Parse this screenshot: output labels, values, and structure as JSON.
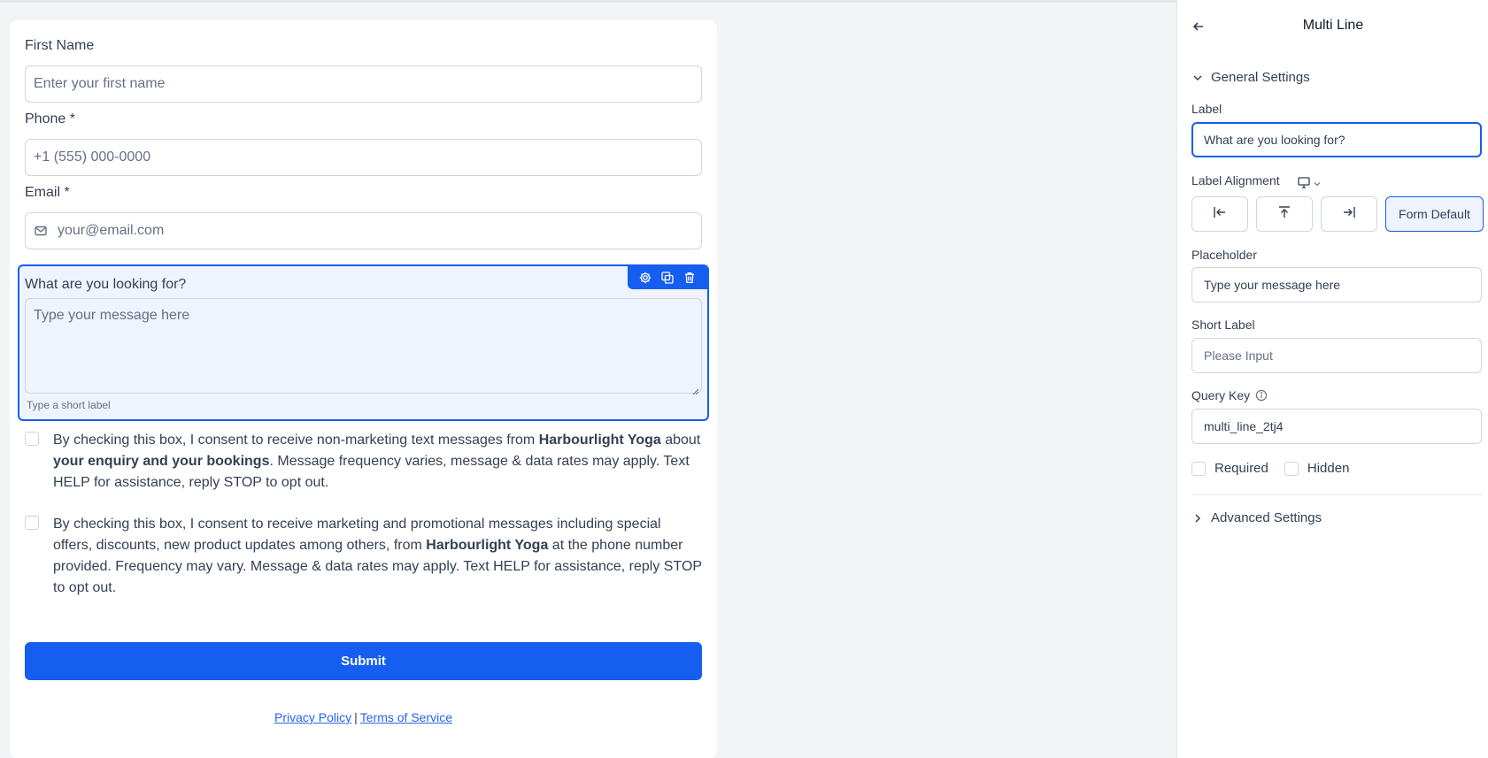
{
  "form": {
    "first_name": {
      "label": "First Name",
      "placeholder": "Enter your first name"
    },
    "phone": {
      "label": "Phone *",
      "placeholder": "+1 (555) 000-0000"
    },
    "email": {
      "label": "Email *",
      "placeholder": "your@email.com"
    },
    "multi_line": {
      "label": "What are you looking for?",
      "placeholder": "Type your message here",
      "short_label": "Type a short label"
    },
    "consent_1": {
      "p1": "By checking this box, I consent to receive non-marketing text messages from ",
      "b1": "Harbourlight Yoga",
      "p2": " about ",
      "b2": "your enquiry and your bookings",
      "p3": ". Message frequency varies, message & data rates may apply. Text HELP for assistance, reply STOP to opt out."
    },
    "consent_2": {
      "p1": "By checking this box, I consent to receive marketing and promotional messages including special offers, discounts, new product updates among others, from ",
      "b1": "Harbourlight Yoga",
      "p2": " at the phone number provided. Frequency may vary. Message & data rates may apply. Text HELP for assistance, reply STOP to opt out."
    },
    "submit_label": "Submit",
    "privacy_label": "Privacy Policy",
    "separator": "|",
    "terms_label": "Terms of Service"
  },
  "panel": {
    "title": "Multi Line",
    "general_settings": "General Settings",
    "label_label": "Label",
    "label_value": "What are you looking for?",
    "label_alignment": "Label Alignment",
    "form_default": "Form Default",
    "placeholder_label": "Placeholder",
    "placeholder_value": "Type your message here",
    "short_label_label": "Short Label",
    "short_label_placeholder": "Please Input",
    "query_key_label": "Query Key",
    "query_key_value": "multi_line_2tj4",
    "required_label": "Required",
    "hidden_label": "Hidden",
    "advanced_settings": "Advanced Settings"
  },
  "colors": {
    "primary": "#155eef",
    "selected_bg": "#eef3fe",
    "border": "#d0d5dd",
    "text": "#344054"
  },
  "icons": [
    "mail-icon",
    "gear-icon",
    "duplicate-icon",
    "trash-icon",
    "back-arrow-icon",
    "chevron-down-icon",
    "chevron-right-icon",
    "monitor-icon",
    "align-left-icon",
    "align-top-icon",
    "align-right-icon",
    "info-icon"
  ]
}
